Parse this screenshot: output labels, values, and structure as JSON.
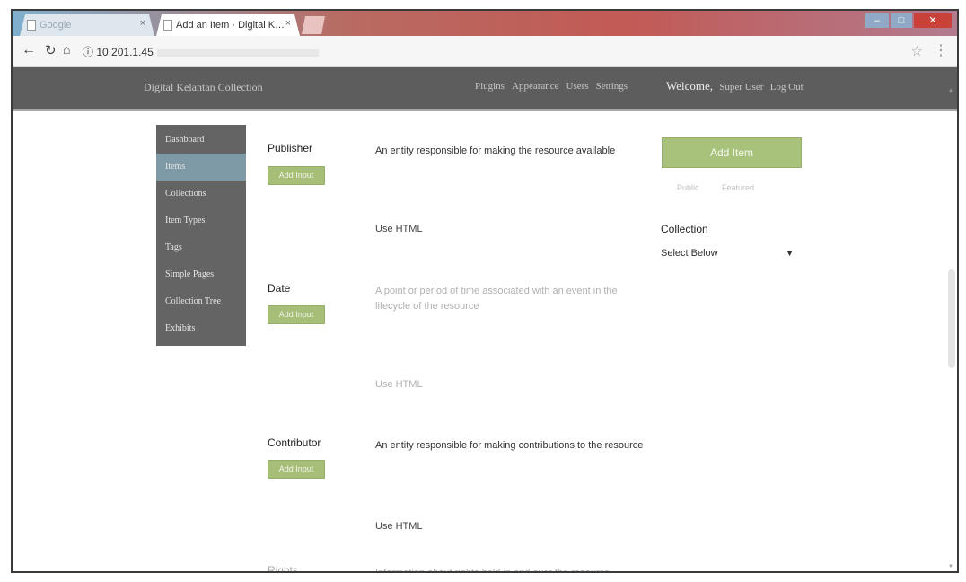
{
  "browser": {
    "tabs": [
      {
        "label": "Google"
      },
      {
        "label": "Add an Item · Digital K…"
      }
    ],
    "tab_close": "×",
    "url": "10.201.1.45"
  },
  "admin": {
    "site_title": "Digital Kelantan Collection",
    "nav": [
      "Plugins",
      "Appearance",
      "Users",
      "Settings"
    ],
    "welcome": "Welcome,",
    "user": "Super User",
    "logout": "Log Out"
  },
  "sidebar": {
    "items": [
      {
        "label": "Dashboard"
      },
      {
        "label": "Items"
      },
      {
        "label": "Collections"
      },
      {
        "label": "Item Types"
      },
      {
        "label": "Tags"
      },
      {
        "label": "Simple Pages"
      },
      {
        "label": "Collection Tree"
      },
      {
        "label": "Exhibits"
      }
    ]
  },
  "fields": [
    {
      "label": "Publisher",
      "description": "An entity responsible for making the resource available",
      "add_input": "Add Input",
      "use_html": "Use HTML"
    },
    {
      "label": "Date",
      "description": "A point or period of time associated with an event in the lifecycle of the resource",
      "add_input": "Add Input",
      "use_html": "Use HTML"
    },
    {
      "label": "Contributor",
      "description": "An entity responsible for making contributions to the resource",
      "add_input": "Add Input",
      "use_html": "Use HTML"
    },
    {
      "label": "Rights",
      "description": "Information about rights held in and over the resource"
    }
  ],
  "panel": {
    "add_item": "Add Item",
    "public": "Public",
    "featured": "Featured",
    "collection_label": "Collection",
    "collection_value": "Select Below"
  },
  "colors": {
    "admin_bar": "#5d5d5d",
    "sidebar": "#646464",
    "sidebar_active": "#7e9aa7",
    "button_green": "#a8c27b"
  }
}
